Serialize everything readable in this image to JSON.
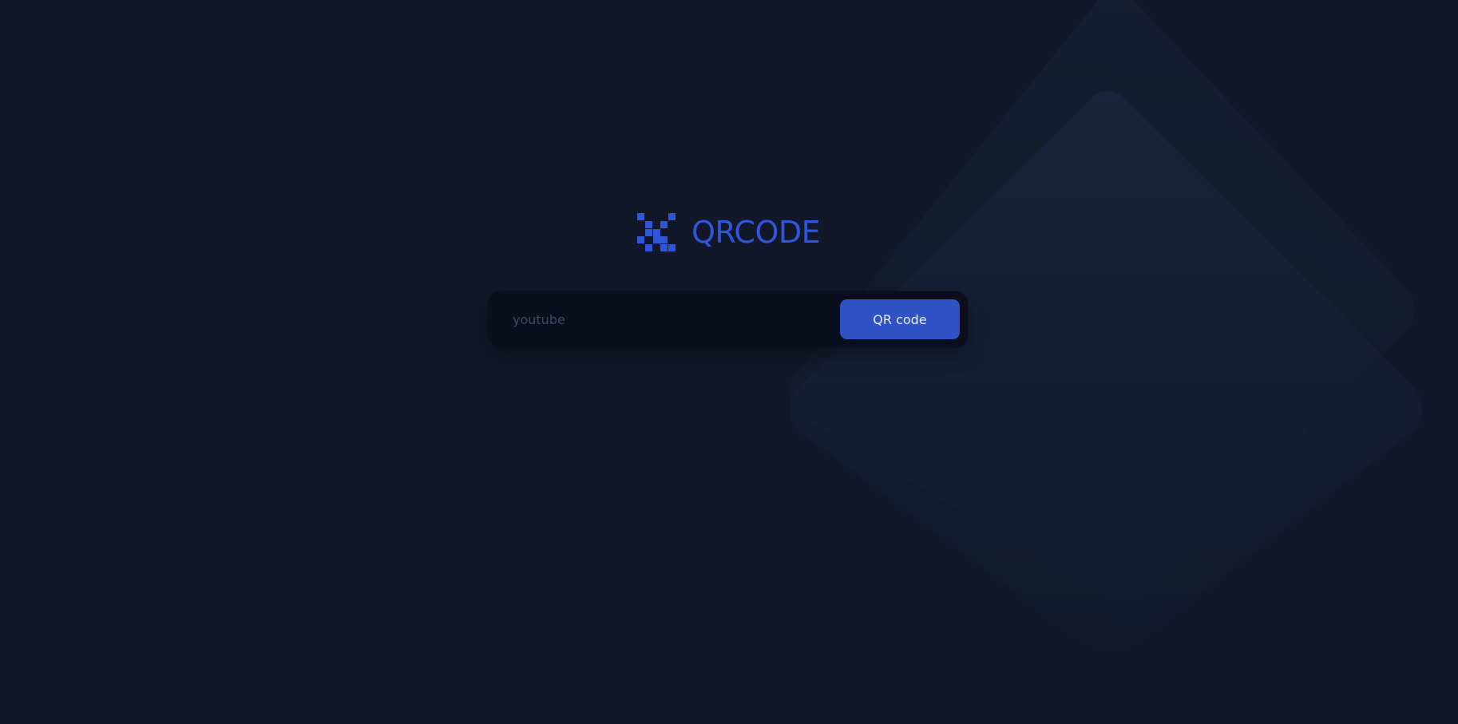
{
  "colors": {
    "background": "#121829",
    "accent": "#2f56d8",
    "button": "#2f53c5",
    "input_background": "#0a0e1d",
    "placeholder": "#414865"
  },
  "logo": {
    "icon": "qr-grid-icon",
    "text": "QRCODE"
  },
  "search": {
    "placeholder": "youtube",
    "value": "",
    "button_label": "QR code"
  }
}
